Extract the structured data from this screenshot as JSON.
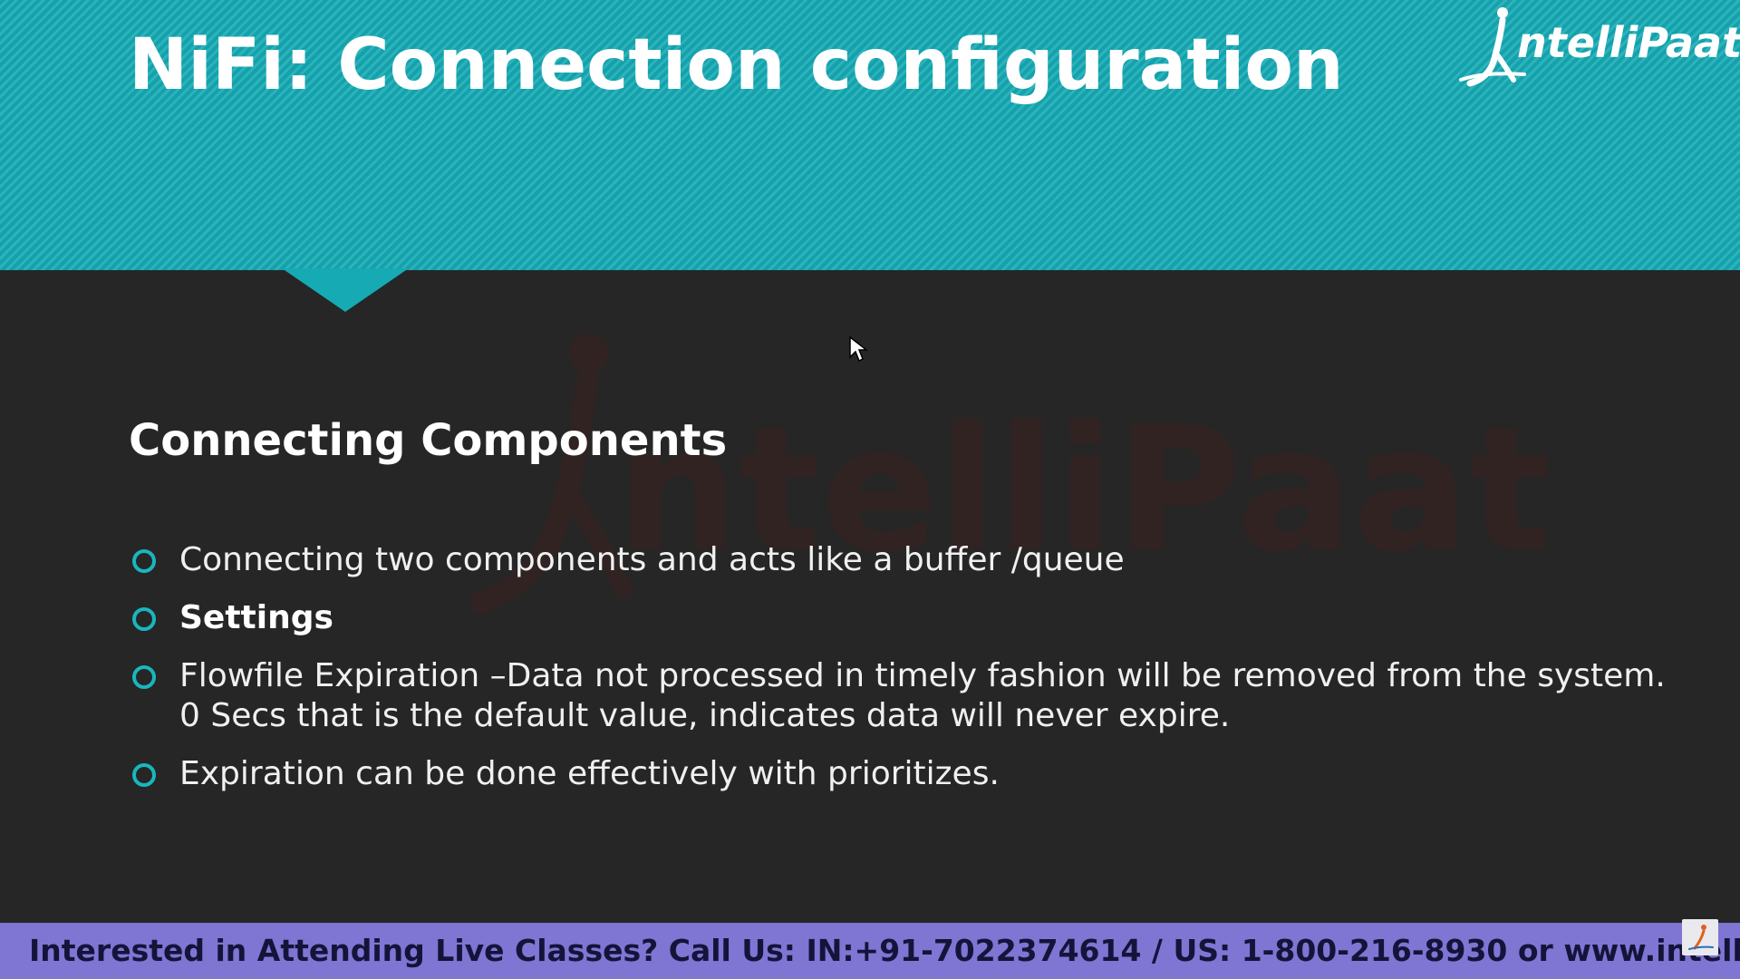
{
  "slide": {
    "title": "NiFi: Connection configuration",
    "section_heading": "Connecting Components",
    "bullets": [
      {
        "lines": [
          "Connecting two components and acts like a buffer /queue"
        ],
        "bold": false
      },
      {
        "lines": [
          "Settings"
        ],
        "bold": true
      },
      {
        "lines": [
          "Flowfile Expiration –Data not processed in timely fashion will be removed from the system.",
          "0 Secs that is the default value, indicates data will never expire."
        ],
        "bold": false
      },
      {
        "lines": [
          "Expiration can be done effectively with prioritizes."
        ],
        "bold": false
      }
    ]
  },
  "logo": {
    "text": "ntelliPaat",
    "icon": "intellipaat-figure-logo"
  },
  "watermark": {
    "text": "ntelliPaat",
    "icon": "intellipaat-figure-logo"
  },
  "footer": {
    "text": "Interested in Attending Live Classes? Call Us: IN:+91-7022374614 / US: 1-800-216-8930 or www.intellipaat.com",
    "icon": "intellipaat-small-logo"
  },
  "colors": {
    "header": "#15aab4",
    "background": "#262626",
    "footer": "#7f75d3",
    "bullet_marker": "#19b6bd",
    "footer_text": "#14143a"
  }
}
